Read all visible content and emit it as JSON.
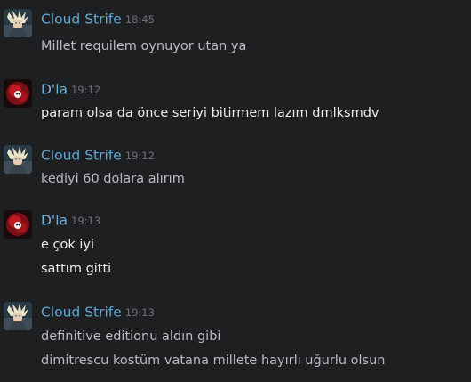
{
  "messages": [
    {
      "author": "Cloud Strife",
      "avatar": "cloud-strife-avatar",
      "time": "18:45",
      "lines": [
        "Millet requilem oynuyor utan ya"
      ]
    },
    {
      "author": "D'la",
      "avatar": "dla-avatar",
      "time": "19:12",
      "lines": [
        "param olsa da önce seriyi bitirmem lazım dmlksmdv"
      ]
    },
    {
      "author": "Cloud Strife",
      "avatar": "cloud-strife-avatar",
      "time": "19:12",
      "lines": [
        "kediyi 60 dolara alırım"
      ]
    },
    {
      "author": "D'la",
      "avatar": "dla-avatar",
      "time": "19:13",
      "lines": [
        "e çok iyi",
        "sattım gitti"
      ]
    },
    {
      "author": "Cloud Strife",
      "avatar": "cloud-strife-avatar",
      "time": "19:13",
      "lines": [
        "definitive editionu aldın gibi",
        "dimitrescu kostüm vatana millete hayırlı uğurlu olsun"
      ]
    }
  ],
  "colors": {
    "background": "#1e1f21",
    "cloud_name": "#5fa8d4",
    "dla_name": "#6cb3e0",
    "timestamp": "#6c6f73"
  }
}
